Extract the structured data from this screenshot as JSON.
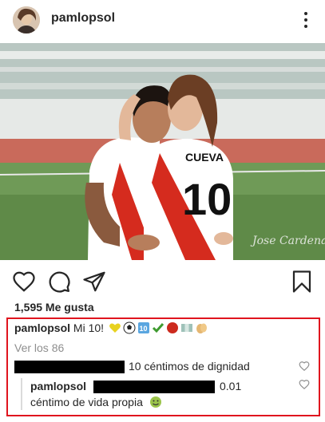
{
  "header": {
    "username": "pamlopsol",
    "more_icon": "more-vertical-icon"
  },
  "post": {
    "jersey_name": "CUEVA",
    "jersey_number": "10",
    "watermark": "Jose Cardenas"
  },
  "actions": {
    "like_icon": "heart-icon",
    "comment_icon": "comment-icon",
    "share_icon": "share-icon",
    "save_icon": "bookmark-icon"
  },
  "likes_text": "1,595 Me gusta",
  "caption": {
    "username": "pamlopsol",
    "text": "Mi 10!",
    "emojis": [
      "heart-emoji",
      "soccer-ball-emoji",
      "ten-emoji",
      "check-emoji",
      "red-circle-emoji",
      "flag-emoji",
      "clap-emoji"
    ]
  },
  "view_all": "Ver los 86",
  "comments": [
    {
      "username": "",
      "text": "10 céntimos de dignidad"
    }
  ],
  "reply": {
    "username": "pamlopsol",
    "text_suffix": "0.01",
    "text": "céntimo de vida propia",
    "emoji": "smiling-face-emoji"
  },
  "colors": {
    "highlight_border": "#e0141e",
    "muted_text": "#8e8e8e",
    "peru_red": "#d52b1e"
  }
}
